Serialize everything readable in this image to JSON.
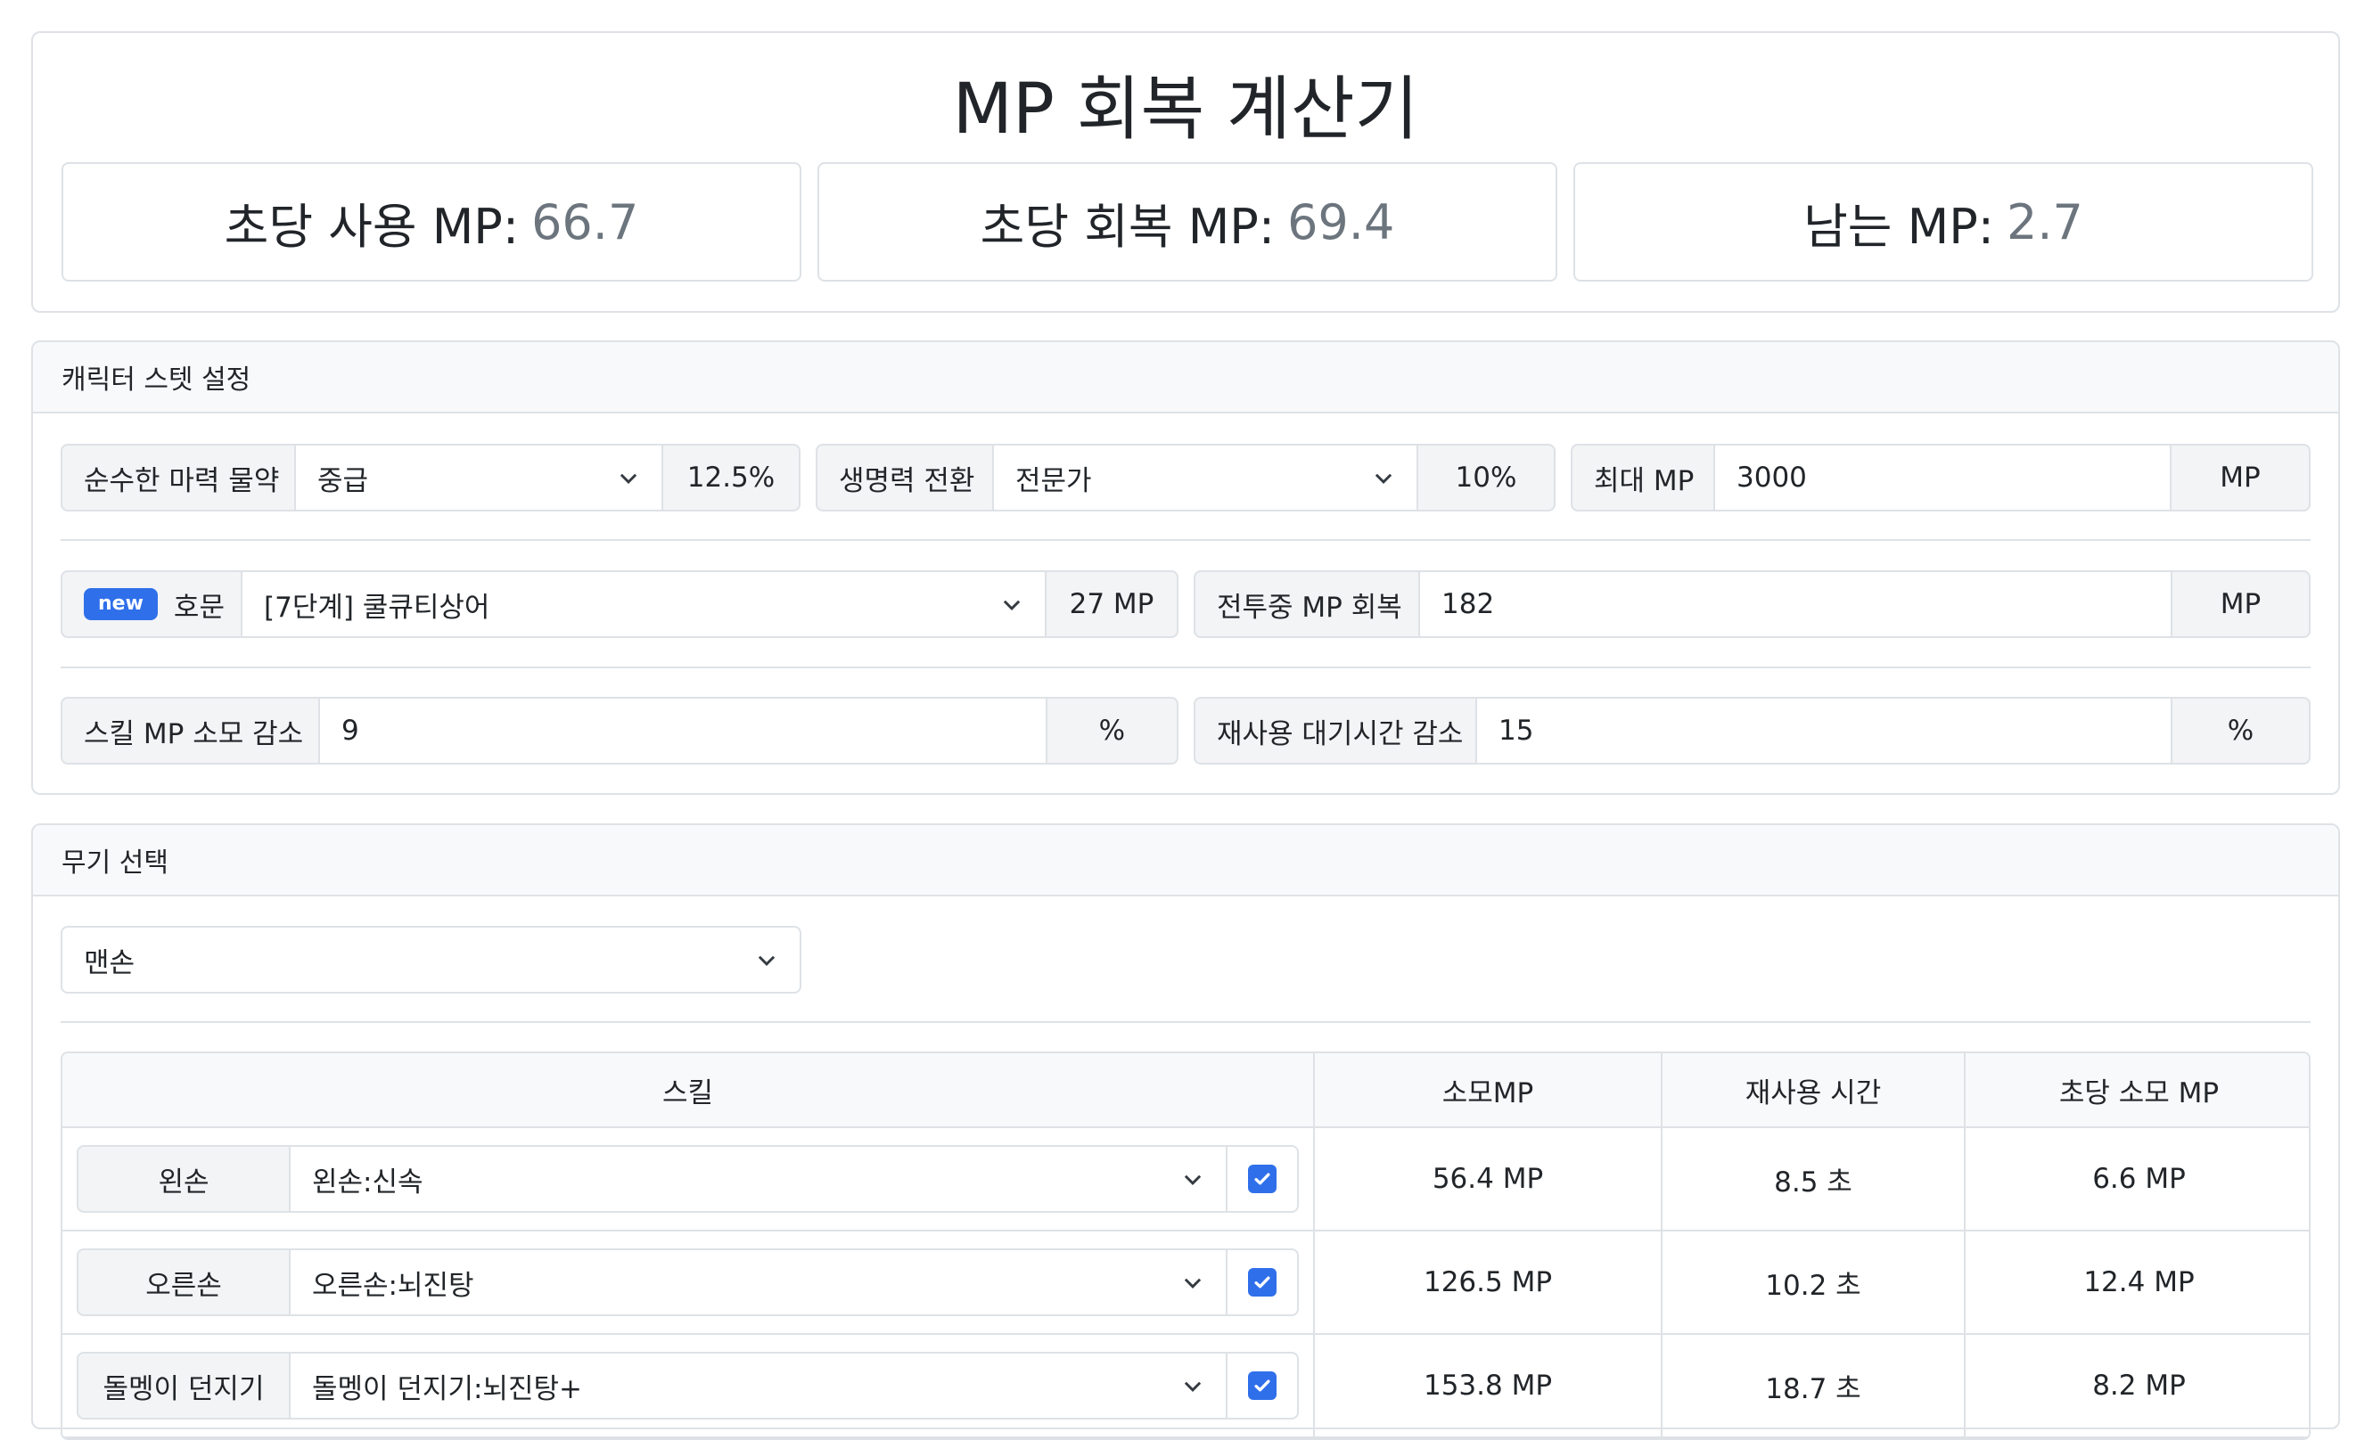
{
  "header": {
    "title": "MP 회복 계산기",
    "stats": [
      {
        "label": "초당 사용 MP:",
        "value": "66.7"
      },
      {
        "label": "초당 회복 MP:",
        "value": "69.4"
      },
      {
        "label": "남는 MP:",
        "value": "2.7"
      }
    ]
  },
  "stats_section": {
    "title": "캐릭터 스텟 설정",
    "potion": {
      "label": "순수한 마력 물약",
      "selected": "중급",
      "value": "12.5%"
    },
    "life_conversion": {
      "label": "생명력 전환",
      "selected": "전문가",
      "value": "10%"
    },
    "max_mp": {
      "label": "최대 MP",
      "value": "3000",
      "unit": "MP"
    },
    "title_item": {
      "badge": "new",
      "label": "호문",
      "selected": "[7단계] 쿨큐티상어",
      "value": "27 MP"
    },
    "combat_mp": {
      "label": "전투중 MP 회복",
      "value": "182",
      "unit": "MP"
    },
    "skill_mp_reduction": {
      "label": "스킬 MP 소모 감소",
      "value": "9",
      "unit": "%"
    },
    "cooldown_reduction": {
      "label": "재사용 대기시간 감소",
      "value": "15",
      "unit": "%"
    }
  },
  "weapon_section": {
    "title": "무기 선택",
    "selected": "맨손",
    "table": {
      "headers": [
        "스킬",
        "소모MP",
        "재사용 시간",
        "초당 소모 MP"
      ],
      "rows": [
        {
          "slot": "왼손",
          "skill": "왼손:신속",
          "checked": true,
          "mp": "56.4 MP",
          "cooldown": "8.5 초",
          "per_sec": "6.6 MP"
        },
        {
          "slot": "오른손",
          "skill": "오른손:뇌진탕",
          "checked": true,
          "mp": "126.5 MP",
          "cooldown": "10.2 초",
          "per_sec": "12.4 MP"
        },
        {
          "slot": "돌멩이 던지기",
          "skill": "돌멩이 던지기:뇌진탕+",
          "checked": true,
          "mp": "153.8 MP",
          "cooldown": "18.7 초",
          "per_sec": "8.2 MP"
        }
      ]
    }
  },
  "icons": {
    "select": "chevron-down-icon",
    "checkbox": "check-icon"
  },
  "colors": {
    "accent": "#2f6fea",
    "muted_value": "#6c757d",
    "border": "#dee2e6",
    "header_bg": "#f8f9fa"
  }
}
